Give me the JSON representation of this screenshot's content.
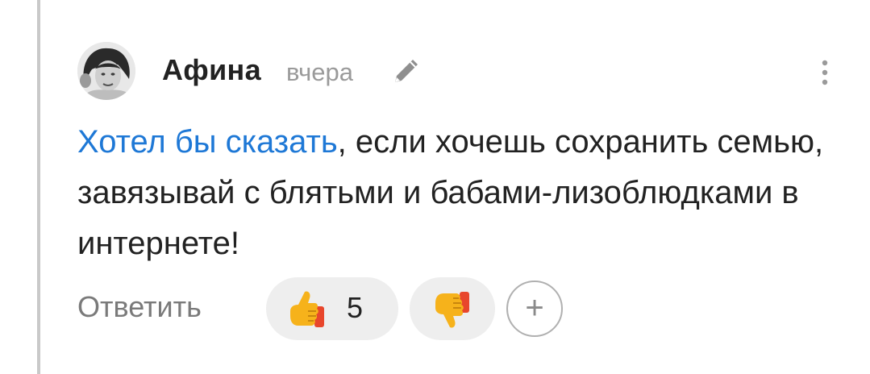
{
  "comment": {
    "author": "Афина",
    "time": "вчера",
    "text_link": "Хотел бы сказать",
    "text_body": ", если хочешь сохранить семью, завязывай с блятьми и бабами-лизоблюдками в интернете!",
    "link_color": "#1e78d6",
    "avatar_icon": "user-photo-avatar",
    "edit_icon": "pencil-icon",
    "menu_icon": "kebab-menu-icon"
  },
  "actions": {
    "reply_label": "Ответить",
    "like_count": "5",
    "like_icon": "thumbs-up-emoji",
    "dislike_icon": "thumbs-down-emoji",
    "add_reaction_label": "+"
  }
}
